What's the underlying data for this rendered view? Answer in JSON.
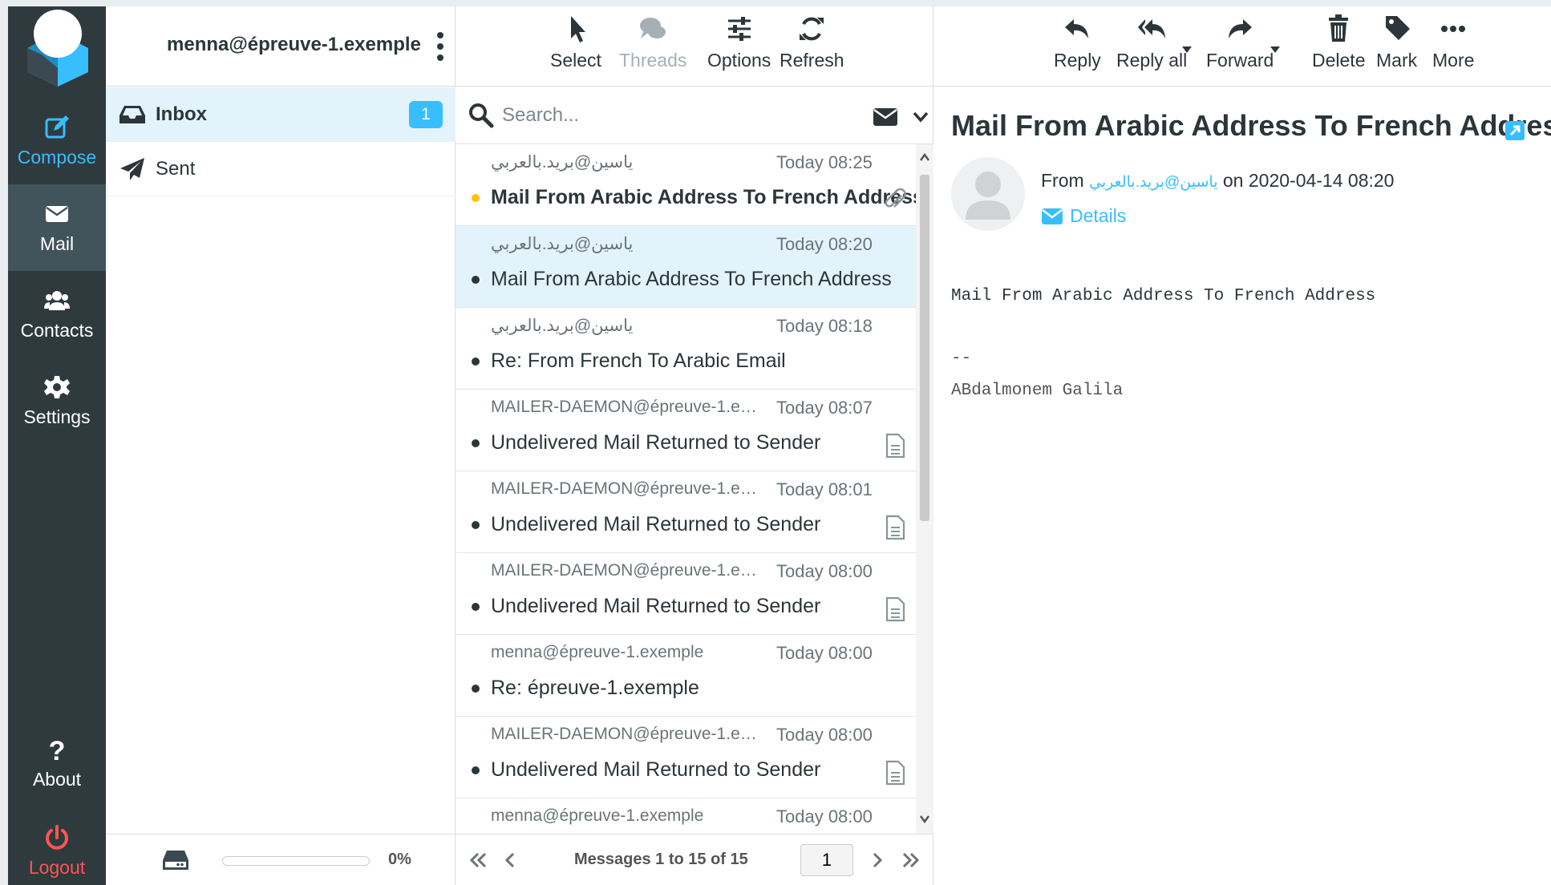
{
  "account": {
    "email": "menna@épreuve-1.exemple"
  },
  "nav": {
    "compose": "Compose",
    "mail": "Mail",
    "contacts": "Contacts",
    "settings": "Settings",
    "about": "About",
    "logout": "Logout"
  },
  "folders": [
    {
      "name": "Inbox",
      "unread": "1",
      "icon": "inbox-icon"
    },
    {
      "name": "Sent",
      "icon": "paper-plane-icon"
    }
  ],
  "quota": {
    "percent_label": "0%",
    "fraction": 0.0
  },
  "list_toolbar": {
    "select": "Select",
    "threads": "Threads",
    "options": "Options",
    "refresh": "Refresh"
  },
  "search": {
    "placeholder": "Search..."
  },
  "messages": [
    {
      "from": "ياسين@بريد.بالعربي",
      "date": "Today 08:25",
      "subject": "Mail From Arabic Address To French Address",
      "unread": true,
      "attachment": "paperclip-icon"
    },
    {
      "from": "ياسين@بريد.بالعربي",
      "date": "Today 08:20",
      "subject": "Mail From Arabic Address To French Address",
      "unread": false
    },
    {
      "from": "ياسين@بريد.بالعربي",
      "date": "Today 08:18",
      "subject": "Re: From French To Arabic Email",
      "unread": false
    },
    {
      "from": "MAILER-DAEMON@épreuve-1.exem…",
      "date": "Today 08:07",
      "subject": "Undelivered Mail Returned to Sender",
      "unread": false,
      "attachment": "document-icon"
    },
    {
      "from": "MAILER-DAEMON@épreuve-1.exem…",
      "date": "Today 08:01",
      "subject": "Undelivered Mail Returned to Sender",
      "unread": false,
      "attachment": "document-icon"
    },
    {
      "from": "MAILER-DAEMON@épreuve-1.exem…",
      "date": "Today 08:00",
      "subject": "Undelivered Mail Returned to Sender",
      "unread": false,
      "attachment": "document-icon"
    },
    {
      "from": "menna@épreuve-1.exemple",
      "date": "Today 08:00",
      "subject": "Re: épreuve-1.exemple",
      "unread": false
    },
    {
      "from": "MAILER-DAEMON@épreuve-1.exem…",
      "date": "Today 08:00",
      "subject": "Undelivered Mail Returned to Sender",
      "unread": false,
      "attachment": "document-icon"
    },
    {
      "from": "menna@épreuve-1.exemple",
      "date": "Today 08:00",
      "subject": "",
      "unread": false
    }
  ],
  "pager": {
    "count": "Messages 1 to 15 of 15",
    "page": "1"
  },
  "reader_toolbar": {
    "reply": "Reply",
    "reply_all": "Reply all",
    "forward": "Forward",
    "delete": "Delete",
    "mark": "Mark",
    "more": "More"
  },
  "message_view": {
    "subject": "Mail From Arabic Address To French Address",
    "from_label": "From",
    "from_addr": "ياسين@بريد.بالعربي",
    "on_text": "on 2020-04-14 08:20",
    "details": "Details",
    "body": "Mail From Arabic Address To French Address",
    "sig_sep": "--",
    "signature": "ABdalmonem Galila"
  },
  "colors": {
    "accent": "#37beff",
    "nav_bg": "#2f3a3f",
    "nav_active": "#41535b",
    "selected_row": "#e3f3fc",
    "logout": "#ff5552",
    "unread_dot": "#ffc107"
  }
}
